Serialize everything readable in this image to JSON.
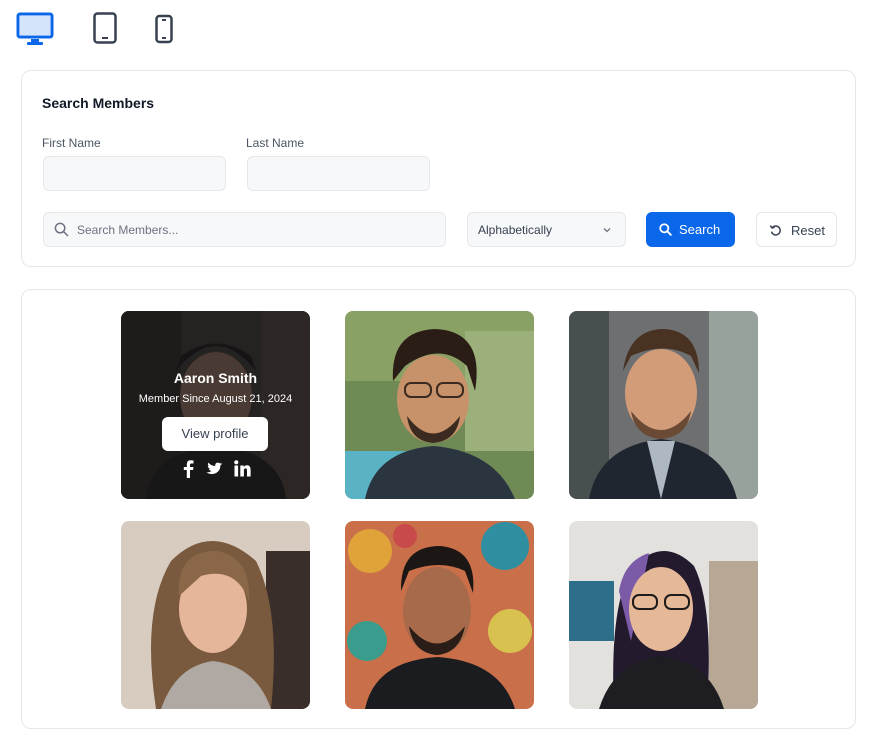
{
  "devices": [
    {
      "name": "desktop-icon",
      "active": true
    },
    {
      "name": "tablet-icon",
      "active": false
    },
    {
      "name": "mobile-icon",
      "active": false
    }
  ],
  "search_panel": {
    "title": "Search Members",
    "first_name_label": "First Name",
    "first_name_value": "",
    "last_name_label": "Last Name",
    "last_name_value": "",
    "search_placeholder": "Search Members...",
    "sort_selected": "Alphabetically",
    "search_button": "Search",
    "reset_button": "Reset"
  },
  "members": [
    {
      "name": "Aaron Smith",
      "member_since": "Member Since August 21, 2024",
      "view_profile": "View profile",
      "hovered": true,
      "socials": [
        "facebook-icon",
        "twitter-icon",
        "linkedin-icon"
      ]
    },
    {
      "hovered": false
    },
    {
      "hovered": false
    },
    {
      "hovered": false
    },
    {
      "hovered": false
    },
    {
      "hovered": false
    }
  ],
  "colors": {
    "accent": "#0b67e9",
    "border": "#e5e7eb",
    "input_bg": "#f7f8f9"
  }
}
